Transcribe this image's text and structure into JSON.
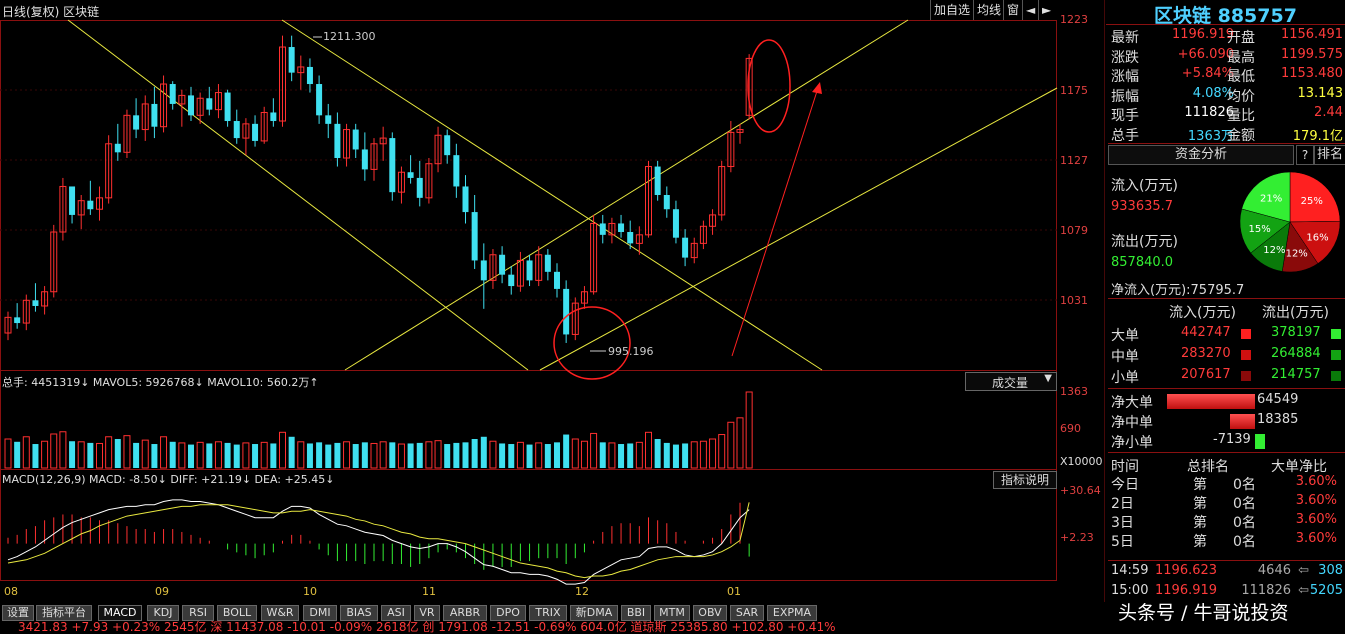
{
  "header": {
    "title": "日线(复权) 区块链",
    "buttons": [
      "加自选",
      "均线",
      "窗",
      "◄",
      "►"
    ]
  },
  "main_chart": {
    "high_label": "1211.300",
    "low_label": "995.196",
    "y_ticks": [
      "1223",
      "1175",
      "1127",
      "1079",
      "1031"
    ]
  },
  "volume": {
    "title": "总手: 4451319↓ MAVOL5: 5926768↓ MAVOL10: 560.2万↑",
    "selector": "成交量",
    "y_ticks": [
      "1363",
      "690"
    ],
    "unit": "X10000"
  },
  "macd": {
    "title": "MACD(12,26,9) MACD: -8.50↓ DIFF: +21.19↓ DEA: +25.45↓",
    "help_button": "指标说明",
    "y_ticks": [
      "+30.64",
      "+2.23"
    ]
  },
  "x_axis": [
    "08",
    "09",
    "10",
    "11",
    "12",
    "01"
  ],
  "bottom_tabs": [
    "设置",
    "指标平台",
    "MACD",
    "KDJ",
    "RSI",
    "BOLL",
    "W&R",
    "DMI",
    "BIAS",
    "ASI",
    "VR",
    "ARBR",
    "DPO",
    "TRIX",
    "新DMA",
    "BBI",
    "MTM",
    "OBV",
    "SAR",
    "EXPMA"
  ],
  "ticker": "3421.83  +7.93  +0.23%  2545亿 深  11437.08  -10.01  -0.09%  2618亿 创  1791.08  -12.51  -0.69%  604.0亿 道琼斯  25385.80  +102.80  +0.41%",
  "panel": {
    "name": "区块链 885757",
    "quote": [
      {
        "k1": "最新",
        "v1": "1196.919",
        "k2": "开盘",
        "v2": "1156.491"
      },
      {
        "k1": "涨跌",
        "v1": "+66.090",
        "k2": "最高",
        "v2": "1199.575"
      },
      {
        "k1": "涨幅",
        "v1": "+5.84%",
        "k2": "最低",
        "v2": "1153.480"
      },
      {
        "k1": "振幅",
        "v1": "4.08%",
        "k2": "均价",
        "v2": "13.143"
      },
      {
        "k1": "现手",
        "v1": "111826",
        "k2": "量比",
        "v2": "2.44"
      },
      {
        "k1": "总手",
        "v1": "1363万",
        "k2": "金额",
        "v2": "179.1亿"
      }
    ],
    "fund_tab": "资金分析",
    "help": "?",
    "rank_tab": "排名",
    "inflow_label": "流入(万元)",
    "inflow_value": "933635.7",
    "outflow_label": "流出(万元)",
    "outflow_value": "857840.0",
    "pie": [
      {
        "label": "25%",
        "value": 25,
        "color": "#ff2020"
      },
      {
        "label": "16%",
        "value": 16,
        "color": "#cc1010"
      },
      {
        "label": "12%",
        "value": 12,
        "color": "#8a0a0a"
      },
      {
        "label": "12%",
        "value": 12,
        "color": "#0a7a0a"
      },
      {
        "label": "15%",
        "value": 15,
        "color": "#13a313"
      },
      {
        "label": "21%",
        "value": 21,
        "color": "#33ee33"
      }
    ],
    "net_inflow": "净流入(万元):75795.7",
    "flow_head": [
      "流入(万元)",
      "流出(万元)"
    ],
    "flows": [
      {
        "name": "大单",
        "in": "442747",
        "out": "378197"
      },
      {
        "name": "中单",
        "in": "283270",
        "out": "264884"
      },
      {
        "name": "小单",
        "in": "207617",
        "out": "214757"
      }
    ],
    "net": [
      {
        "name": "净大单",
        "value": "64549",
        "ratio": 1.0
      },
      {
        "name": "净中单",
        "value": "18385",
        "ratio": 0.28
      },
      {
        "name": "净小单",
        "value": "-7139",
        "ratio": 0.11
      }
    ],
    "rank_head": [
      "时间",
      "总排名",
      "大单净比"
    ],
    "ranks": [
      {
        "t": "今日",
        "r": "第",
        "n": "0名",
        "p": "3.60%"
      },
      {
        "t": "2日",
        "r": "第",
        "n": "0名",
        "p": "3.60%"
      },
      {
        "t": "3日",
        "r": "第",
        "n": "0名",
        "p": "3.60%"
      },
      {
        "t": "5日",
        "r": "第",
        "n": "0名",
        "p": "3.60%"
      }
    ],
    "ticks": [
      {
        "time": "14:59",
        "price": "1196.623",
        "vol": "4646",
        "n": "308"
      },
      {
        "time": "15:00",
        "price": "1196.919",
        "vol": "111826",
        "n": "5205"
      }
    ],
    "watermark": "头条号 / 牛哥说投资"
  },
  "chart_data": {
    "type": "candlestick",
    "x": [
      "08",
      "09",
      "10",
      "11",
      "12",
      "01"
    ],
    "ylim": [
      995,
      1223
    ],
    "ohlc": [
      [
        1003,
        1018,
        998,
        1014
      ],
      [
        1014,
        1024,
        1006,
        1010
      ],
      [
        1010,
        1030,
        1005,
        1026
      ],
      [
        1026,
        1038,
        1018,
        1022
      ],
      [
        1022,
        1036,
        1016,
        1032
      ],
      [
        1032,
        1079,
        1028,
        1074
      ],
      [
        1074,
        1112,
        1068,
        1106
      ],
      [
        1106,
        1092,
        1080,
        1086
      ],
      [
        1086,
        1100,
        1076,
        1096
      ],
      [
        1096,
        1110,
        1086,
        1090
      ],
      [
        1090,
        1106,
        1082,
        1098
      ],
      [
        1098,
        1142,
        1094,
        1136
      ],
      [
        1136,
        1150,
        1124,
        1130
      ],
      [
        1130,
        1160,
        1126,
        1156
      ],
      [
        1156,
        1168,
        1140,
        1146
      ],
      [
        1146,
        1170,
        1138,
        1164
      ],
      [
        1164,
        1176,
        1140,
        1148
      ],
      [
        1148,
        1184,
        1144,
        1178
      ],
      [
        1178,
        1180,
        1160,
        1164
      ],
      [
        1164,
        1174,
        1148,
        1170
      ],
      [
        1170,
        1176,
        1152,
        1156
      ],
      [
        1156,
        1172,
        1150,
        1168
      ],
      [
        1168,
        1176,
        1156,
        1160
      ],
      [
        1160,
        1178,
        1154,
        1172
      ],
      [
        1172,
        1174,
        1148,
        1152
      ],
      [
        1152,
        1160,
        1136,
        1140
      ],
      [
        1140,
        1154,
        1128,
        1150
      ],
      [
        1150,
        1156,
        1134,
        1138
      ],
      [
        1138,
        1162,
        1136,
        1158
      ],
      [
        1158,
        1168,
        1148,
        1152
      ],
      [
        1152,
        1212,
        1148,
        1204
      ],
      [
        1204,
        1212,
        1180,
        1186
      ],
      [
        1186,
        1198,
        1174,
        1190
      ],
      [
        1190,
        1196,
        1172,
        1178
      ],
      [
        1178,
        1184,
        1150,
        1156
      ],
      [
        1156,
        1164,
        1140,
        1150
      ],
      [
        1150,
        1158,
        1120,
        1126
      ],
      [
        1126,
        1150,
        1120,
        1146
      ],
      [
        1146,
        1150,
        1126,
        1132
      ],
      [
        1132,
        1144,
        1110,
        1118
      ],
      [
        1118,
        1140,
        1110,
        1136
      ],
      [
        1136,
        1148,
        1124,
        1140
      ],
      [
        1140,
        1144,
        1096,
        1102
      ],
      [
        1102,
        1120,
        1094,
        1116
      ],
      [
        1116,
        1128,
        1108,
        1112
      ],
      [
        1112,
        1124,
        1092,
        1098
      ],
      [
        1098,
        1126,
        1094,
        1122
      ],
      [
        1122,
        1148,
        1116,
        1142
      ],
      [
        1142,
        1146,
        1122,
        1128
      ],
      [
        1128,
        1136,
        1098,
        1106
      ],
      [
        1106,
        1114,
        1080,
        1088
      ],
      [
        1088,
        1100,
        1048,
        1054
      ],
      [
        1054,
        1066,
        1020,
        1040
      ],
      [
        1040,
        1062,
        1034,
        1058
      ],
      [
        1058,
        1064,
        1038,
        1044
      ],
      [
        1044,
        1050,
        1030,
        1036
      ],
      [
        1036,
        1060,
        1032,
        1054
      ],
      [
        1054,
        1058,
        1036,
        1040
      ],
      [
        1040,
        1064,
        1036,
        1058
      ],
      [
        1058,
        1062,
        1040,
        1046
      ],
      [
        1046,
        1052,
        1028,
        1034
      ],
      [
        1034,
        1040,
        996,
        1002
      ],
      [
        1002,
        1028,
        998,
        1024
      ],
      [
        1024,
        1036,
        1020,
        1032
      ],
      [
        1032,
        1086,
        1030,
        1080
      ],
      [
        1080,
        1086,
        1066,
        1072
      ],
      [
        1072,
        1084,
        1066,
        1080
      ],
      [
        1080,
        1086,
        1070,
        1074
      ],
      [
        1074,
        1082,
        1062,
        1066
      ],
      [
        1066,
        1078,
        1058,
        1072
      ],
      [
        1072,
        1124,
        1070,
        1120
      ],
      [
        1120,
        1124,
        1096,
        1100
      ],
      [
        1100,
        1106,
        1084,
        1090
      ],
      [
        1090,
        1096,
        1066,
        1070
      ],
      [
        1070,
        1076,
        1050,
        1056
      ],
      [
        1056,
        1070,
        1052,
        1066
      ],
      [
        1066,
        1082,
        1062,
        1078
      ],
      [
        1078,
        1090,
        1072,
        1086
      ],
      [
        1086,
        1124,
        1082,
        1120
      ],
      [
        1120,
        1152,
        1116,
        1144
      ],
      [
        1144,
        1150,
        1136,
        1146
      ],
      [
        1156,
        1199,
        1153,
        1196
      ]
    ],
    "volume": [
      520,
      470,
      560,
      430,
      480,
      610,
      650,
      480,
      470,
      450,
      440,
      560,
      520,
      580,
      450,
      500,
      430,
      560,
      470,
      450,
      420,
      460,
      440,
      470,
      450,
      420,
      450,
      430,
      460,
      440,
      640,
      560,
      470,
      440,
      460,
      420,
      450,
      470,
      430,
      460,
      440,
      470,
      460,
      430,
      440,
      450,
      470,
      490,
      430,
      450,
      460,
      520,
      560,
      480,
      440,
      430,
      460,
      420,
      450,
      430,
      460,
      600,
      520,
      480,
      620,
      460,
      450,
      430,
      440,
      460,
      640,
      520,
      450,
      420,
      440,
      470,
      480,
      520,
      600,
      820,
      900,
      1363
    ],
    "diff": [
      -10,
      -8,
      -5,
      -2,
      2,
      6,
      10,
      13,
      15,
      17,
      19,
      21,
      22,
      23,
      23,
      24,
      24,
      26,
      27,
      27,
      26,
      26,
      25,
      24,
      22,
      20,
      18,
      16,
      16,
      16,
      20,
      23,
      23,
      22,
      18,
      15,
      12,
      11,
      9,
      7,
      6,
      5,
      2,
      0,
      -2,
      -3,
      -2,
      0,
      0,
      -2,
      -5,
      -9,
      -13,
      -14,
      -16,
      -18,
      -18,
      -19,
      -19,
      -20,
      -22,
      -25,
      -25,
      -24,
      -19,
      -16,
      -13,
      -10,
      -9,
      -8,
      -3,
      -2,
      -2,
      -4,
      -7,
      -8,
      -7,
      -5,
      0,
      8,
      16,
      21
    ],
    "dea": [
      -12,
      -11,
      -10,
      -8,
      -6,
      -3,
      0,
      3,
      6,
      8,
      11,
      13,
      15,
      17,
      18,
      19,
      20,
      21,
      22,
      23,
      23,
      24,
      24,
      24,
      24,
      23,
      22,
      21,
      20,
      19,
      19,
      20,
      20,
      21,
      20,
      19,
      18,
      17,
      15,
      14,
      12,
      11,
      9,
      7,
      6,
      4,
      3,
      3,
      2,
      1,
      0,
      -2,
      -4,
      -6,
      -8,
      -10,
      -12,
      -13,
      -14,
      -15,
      -17,
      -18,
      -20,
      -21,
      -20,
      -20,
      -19,
      -17,
      -16,
      -14,
      -12,
      -10,
      -9,
      -8,
      -8,
      -8,
      -8,
      -7,
      -5,
      -2,
      2,
      25.45
    ]
  }
}
